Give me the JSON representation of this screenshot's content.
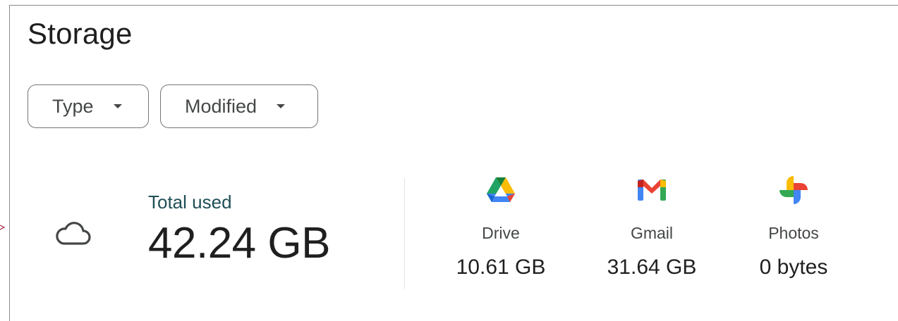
{
  "page": {
    "title": "Storage"
  },
  "filters": [
    {
      "label": "Type"
    },
    {
      "label": "Modified"
    }
  ],
  "summary": {
    "icon": "cloud-icon",
    "label": "Total used",
    "value": "42.24 GB"
  },
  "services": [
    {
      "name": "Drive",
      "amount": "10.61 GB",
      "icon": "google-drive-icon"
    },
    {
      "name": "Gmail",
      "amount": "31.64 GB",
      "icon": "gmail-icon"
    },
    {
      "name": "Photos",
      "amount": "0 bytes",
      "icon": "google-photos-icon"
    }
  ],
  "colors": {
    "google_blue": "#4285F4",
    "google_red": "#EA4335",
    "google_yellow": "#FBBC04",
    "google_green": "#34A853",
    "chip_border": "#747775"
  }
}
